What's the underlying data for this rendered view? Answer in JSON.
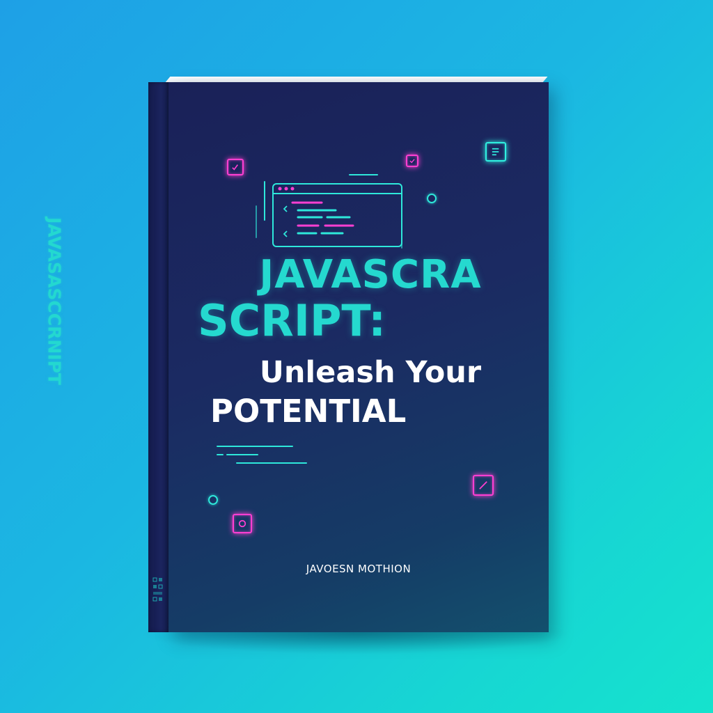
{
  "book": {
    "title_line_1": "JAVASCRA",
    "title_line_2": "SCRIPT:",
    "subtitle_line_1": "Unleash Your",
    "subtitle_line_2": "POTENTIAL",
    "spine_title": "JAVASASCCRNIPT",
    "author": "JAVOESN MOTHION"
  },
  "colors": {
    "background_start": "#1ea0e6",
    "background_end": "#15e3cd",
    "cover": "#1a2158",
    "title_accent": "#25d9cf",
    "neon_pink": "#ff3fd2",
    "neon_cyan": "#2ff0e0",
    "text_white": "#ffffff"
  },
  "icons": [
    "checkbox-icon",
    "checkbox-icon",
    "list-box-icon",
    "circle-icon",
    "code-window-icon",
    "slash-box-icon",
    "circle-icon",
    "target-box-icon"
  ]
}
